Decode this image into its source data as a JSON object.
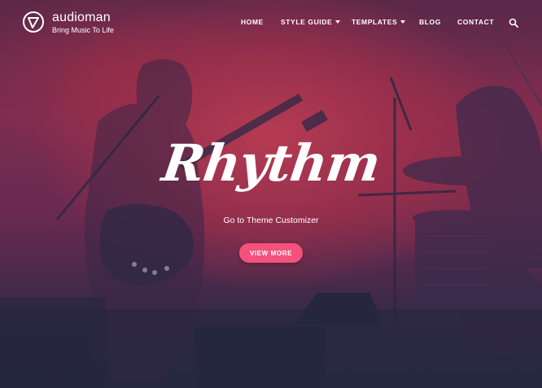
{
  "brand": {
    "name": "audioman",
    "tagline": "Bring Music To Life",
    "logo_icon": "triangle-circle-logo-icon"
  },
  "nav": {
    "items": [
      {
        "label": "HOME",
        "has_dropdown": false
      },
      {
        "label": "STYLE GUIDE",
        "has_dropdown": true
      },
      {
        "label": "TEMPLATES",
        "has_dropdown": true
      },
      {
        "label": "BLOG",
        "has_dropdown": false
      },
      {
        "label": "CONTACT",
        "has_dropdown": false
      }
    ],
    "search_icon": "search-icon"
  },
  "hero": {
    "title": "Rhythm",
    "subtitle": "Go to Theme Customizer",
    "button_label": "VIEW MORE",
    "button_color": "#f4527d",
    "overlay_color": "#b93c52"
  }
}
